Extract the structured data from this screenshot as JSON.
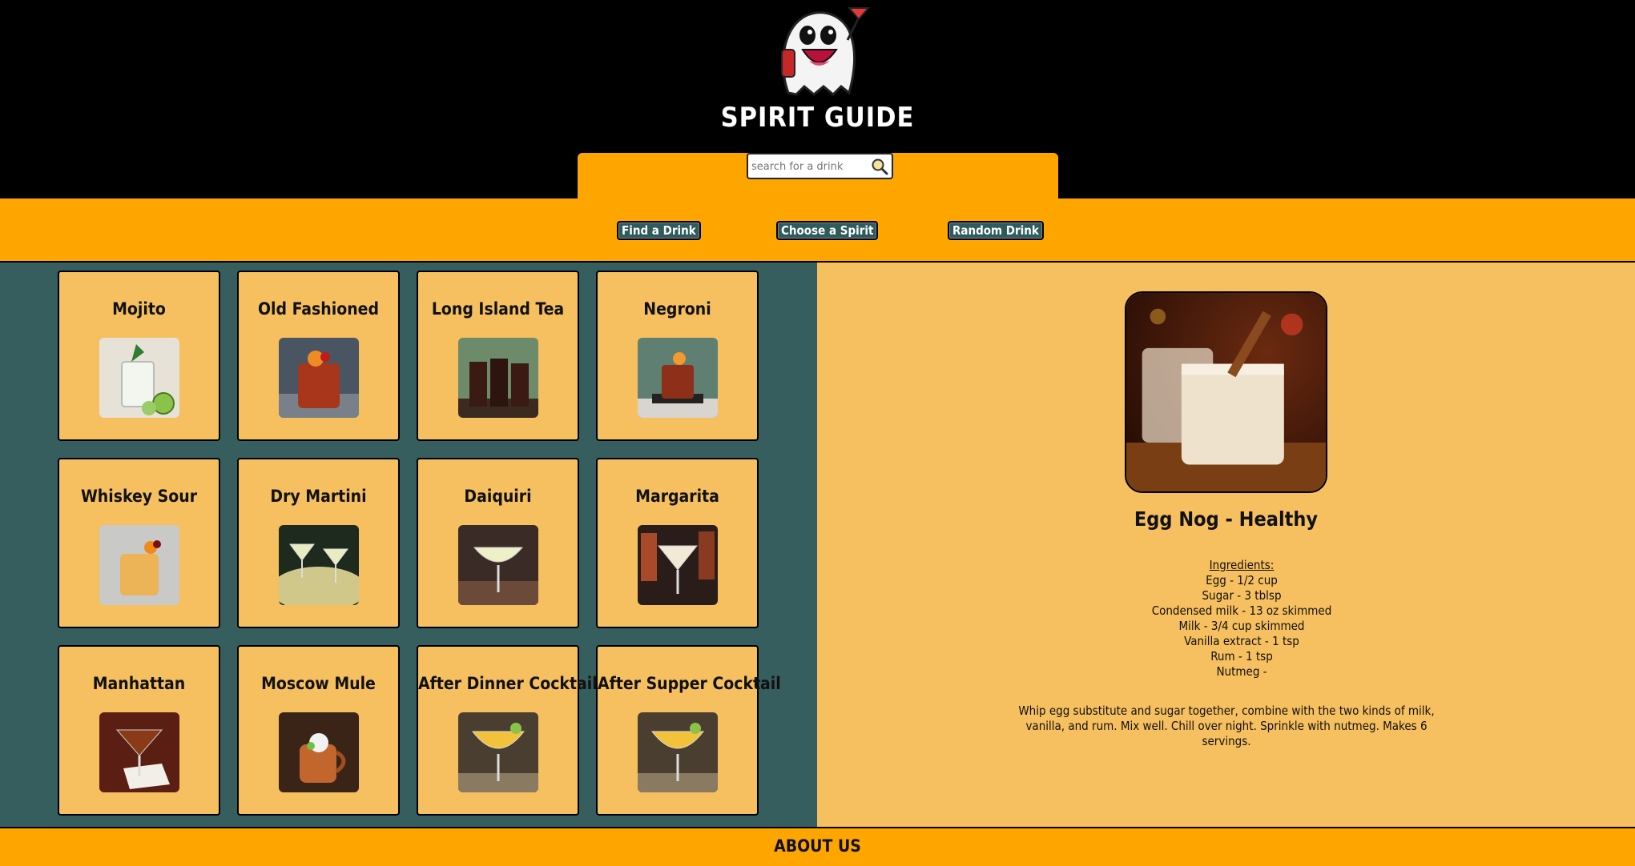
{
  "header": {
    "title": "SPIRIT GUIDE",
    "logo_icon": "ghost-holding-martini-icon"
  },
  "search": {
    "placeholder": "search for a drink",
    "value": "",
    "icon": "magnifier-icon"
  },
  "nav": {
    "find": "Find a Drink",
    "choose": "Choose a Spirit",
    "random": "Random Drink"
  },
  "drinks": [
    {
      "name": "Mojito"
    },
    {
      "name": "Old Fashioned"
    },
    {
      "name": "Long Island Tea"
    },
    {
      "name": "Negroni"
    },
    {
      "name": "Whiskey Sour"
    },
    {
      "name": "Dry Martini"
    },
    {
      "name": "Daiquiri"
    },
    {
      "name": "Margarita"
    },
    {
      "name": "Manhattan"
    },
    {
      "name": "Moscow Mule"
    },
    {
      "name": "After Dinner Cocktail"
    },
    {
      "name": "After Supper Cocktail"
    }
  ],
  "detail": {
    "name": "Egg Nog - Healthy",
    "ingredients_header": "Ingredients:",
    "ingredients": [
      "Egg - 1/2 cup",
      "Sugar - 3 tblsp",
      "Condensed milk - 13 oz skimmed",
      "Milk - 3/4 cup skimmed",
      "Vanilla extract - 1 tsp",
      "Rum - 1 tsp",
      "Nutmeg -"
    ],
    "instructions": "Whip egg substitute and sugar together, combine with the two kinds of milk, vanilla, and rum. Mix well. Chill over night. Sprinkle with nutmeg. Makes 6 servings."
  },
  "footer": {
    "about": "ABOUT US"
  },
  "colors": {
    "header_bg": "#000000",
    "accent_orange": "#ffa500",
    "panel_teal": "#365e5f",
    "card_tan": "#f6bf5f",
    "button_teal": "#2f5b5d"
  }
}
